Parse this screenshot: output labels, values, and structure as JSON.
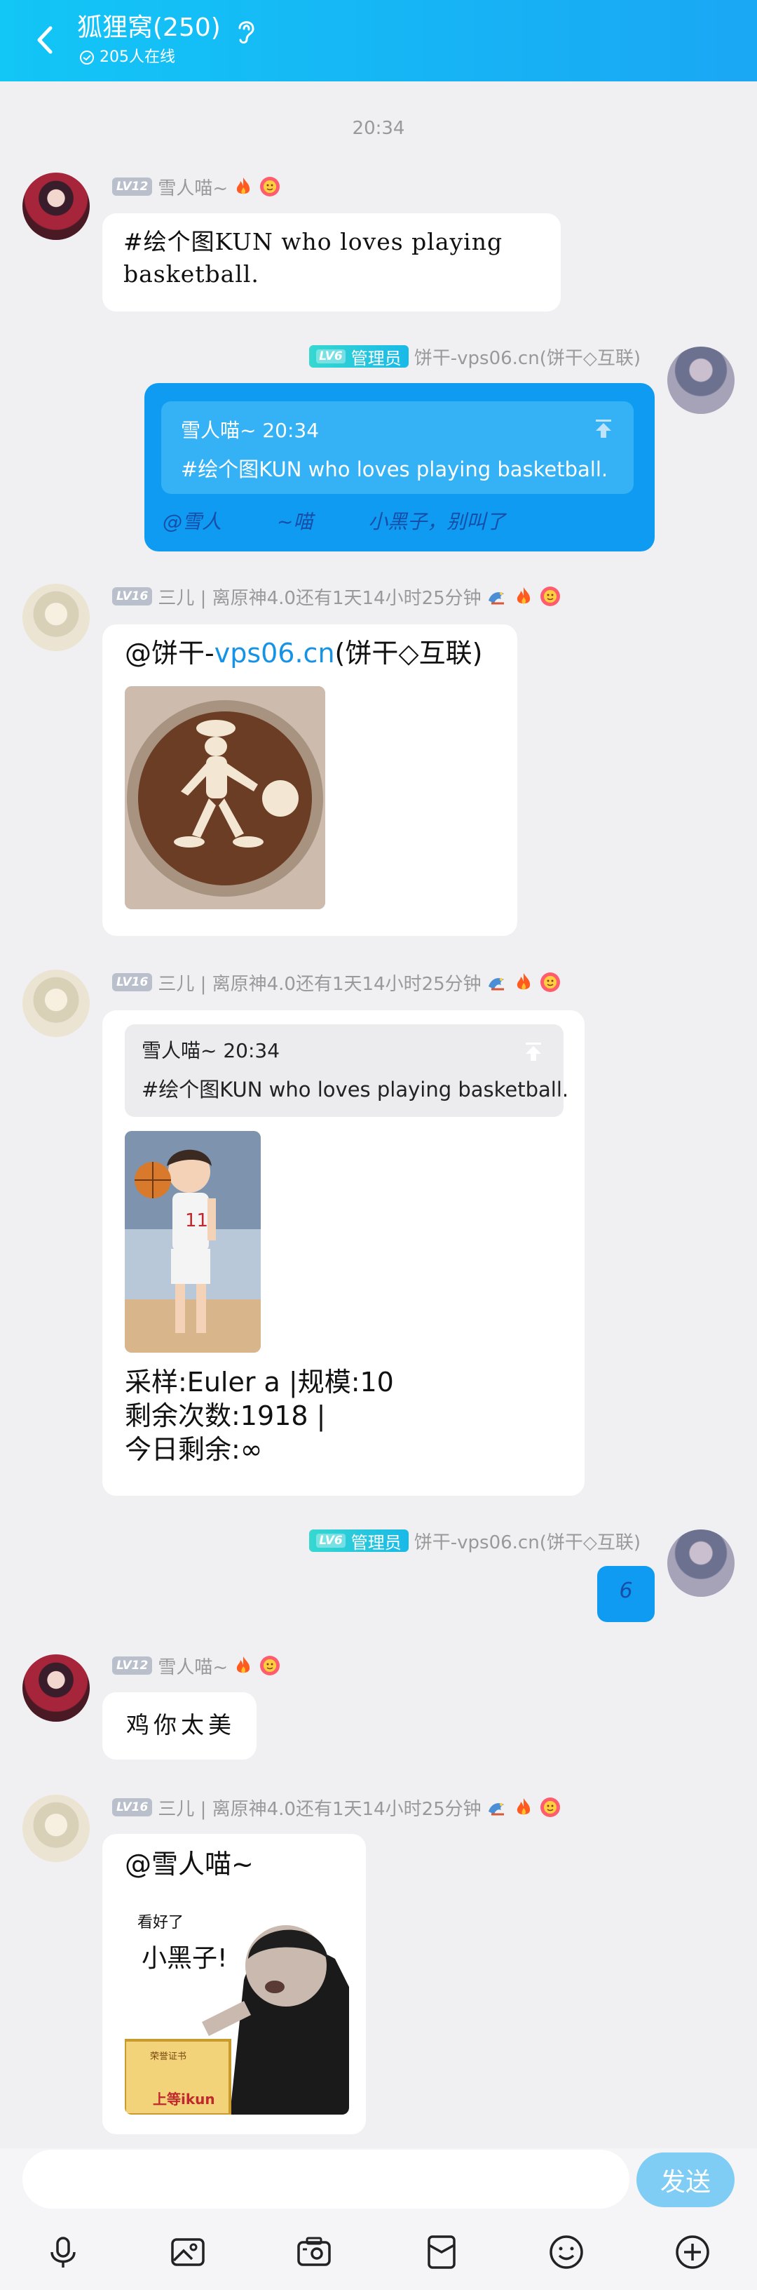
{
  "header": {
    "title": "狐狸窝(250)",
    "online": "205人在线"
  },
  "timestamp": "20:34",
  "messages": [
    {
      "level": "LV12",
      "sender": "雪人喵~",
      "text": "#绘个图KUN who loves playing\nbasketball."
    },
    {
      "admin_level": "LV6",
      "admin_label": "管理员",
      "sender": "饼干-vps06.cn(饼干◇互联)",
      "quote_head": "雪人喵~ 20:34",
      "quote_body": "#绘个图KUN who loves playing basketball.",
      "mentions": [
        "@雪人",
        "~喵",
        "小黑子，别叫了"
      ]
    },
    {
      "level": "LV16",
      "sender": "三儿 | 离原神4.0还有1天14小时25分钟",
      "text_prefix": "@饼干-",
      "text_link": "vps06.cn",
      "text_suffix": "(饼干◇互联)"
    },
    {
      "level": "LV16",
      "sender": "三儿 | 离原神4.0还有1天14小时25分钟",
      "quote_head": "雪人喵~ 20:34",
      "quote_body": "#绘个图KUN who loves playing basketball.",
      "info_lines": [
        "采样:Euler a |规模:10",
        "剩余次数:1918  |",
        "今日剩余:∞"
      ]
    },
    {
      "admin_level": "LV6",
      "admin_label": "管理员",
      "sender": "饼干-vps06.cn(饼干◇互联)",
      "text": "6"
    },
    {
      "level": "LV12",
      "sender": "雪人喵~",
      "text": "鸡你太美"
    },
    {
      "level": "LV16",
      "sender": "三儿 | 离原神4.0还有1天14小时25分钟",
      "text": "@雪人喵~",
      "meme_small": "看好了",
      "meme_big": "小黑子!",
      "meme_cert": "荣誉证书",
      "meme_cert_foot": "上等ikun"
    }
  ],
  "input": {
    "placeholder": "",
    "send_label": "发送"
  },
  "toolbar": [
    "mic-icon",
    "image-icon",
    "camera-icon",
    "red-packet-icon",
    "emoji-icon",
    "plus-icon"
  ],
  "colors": {
    "header": "#12c6f6",
    "self_bubble": "#0f9bf2",
    "send_button": "#7fcdf5",
    "link": "#1593e6"
  }
}
